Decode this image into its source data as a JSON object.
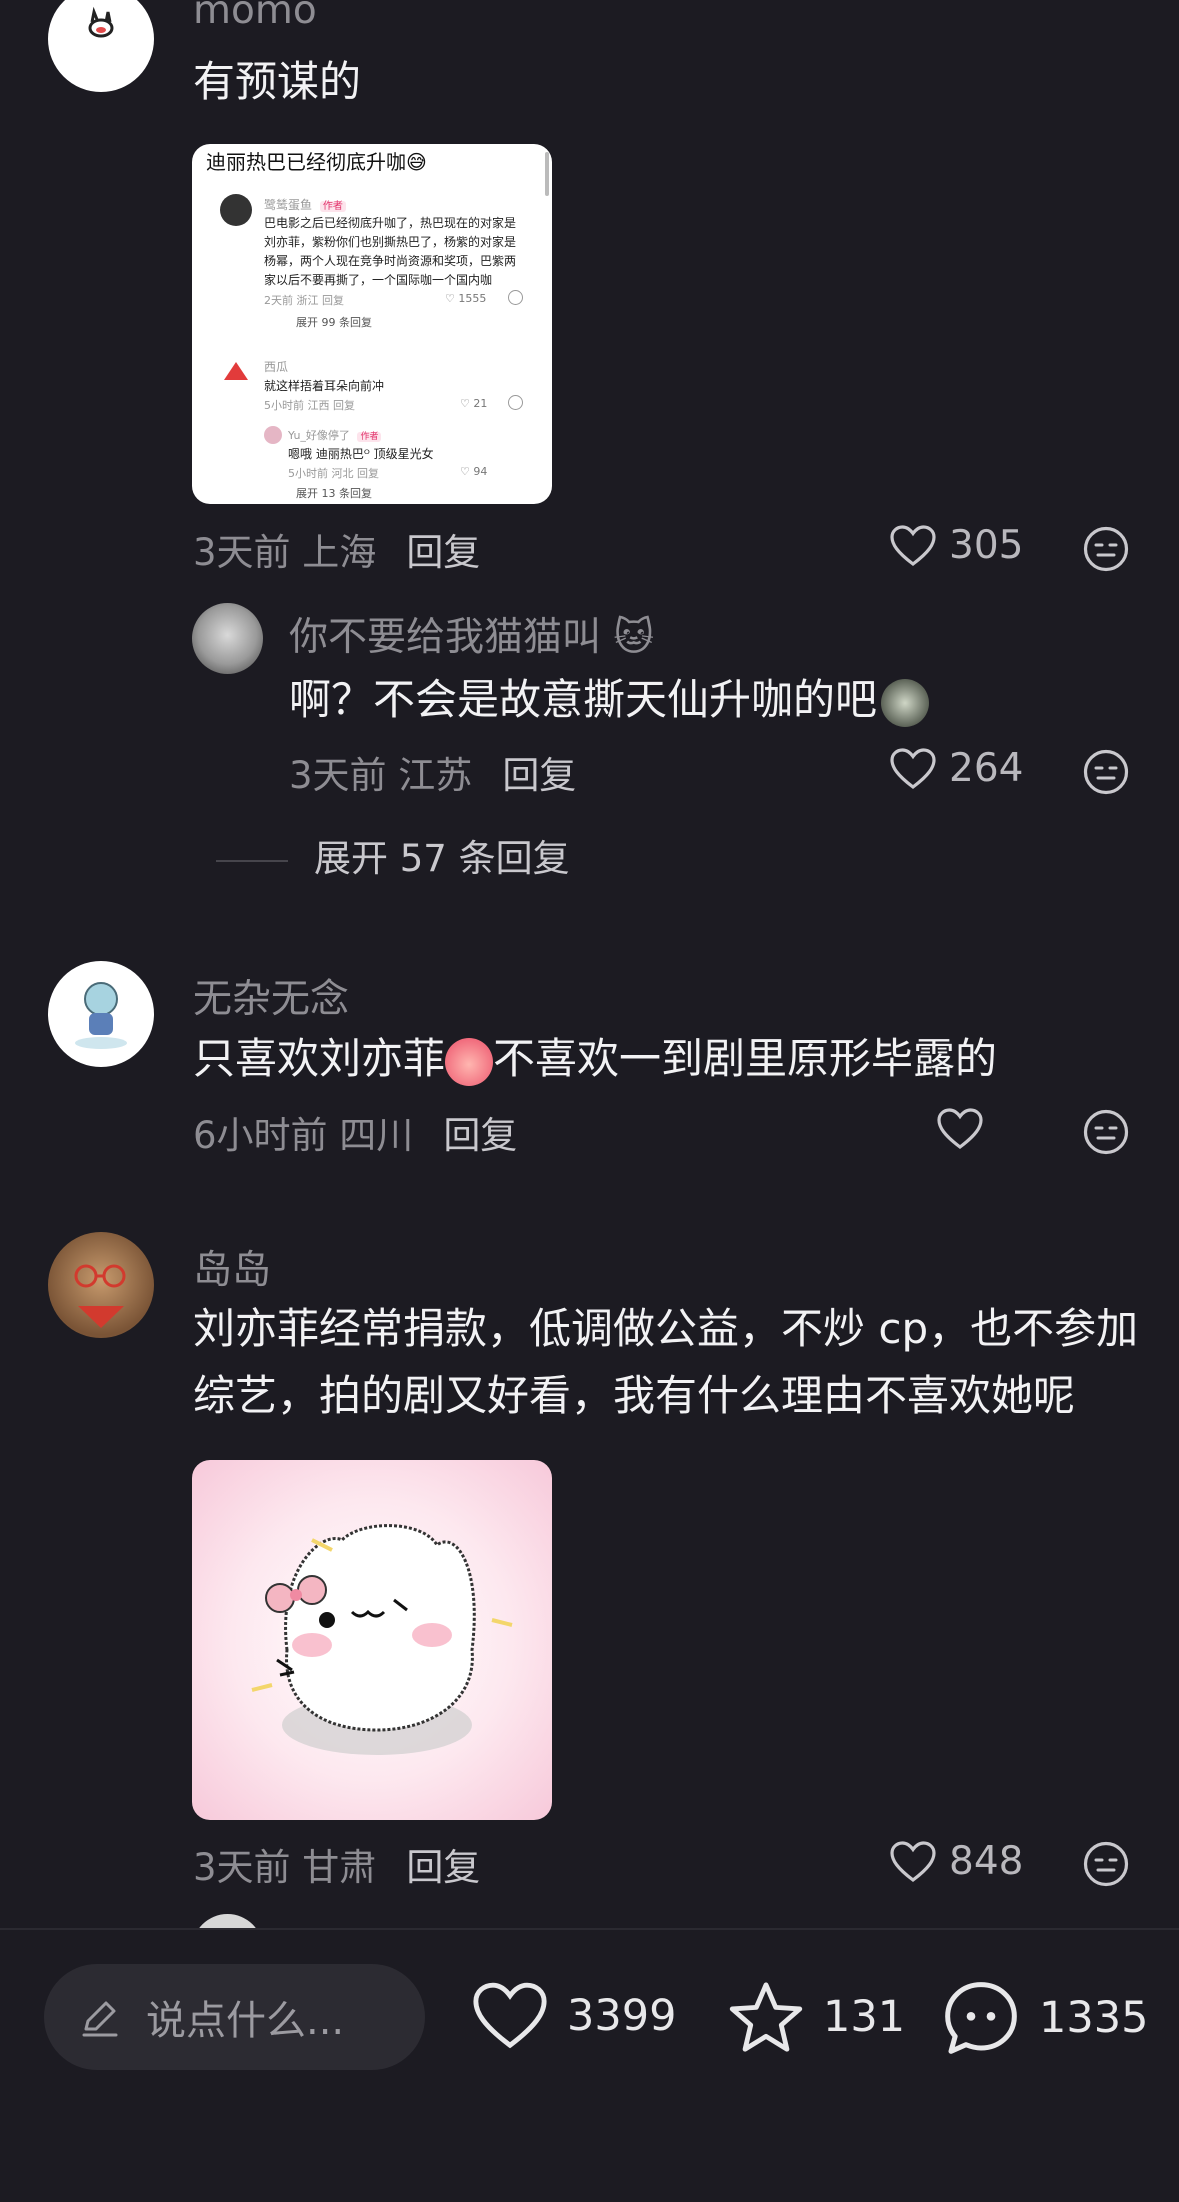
{
  "comments": [
    {
      "username": "momo",
      "text": "有预谋的",
      "image": {
        "title": "迪丽热巴已经彻底升咖😅",
        "c1_name": "鹭鸶蛋鱼",
        "c1_tag": "作者",
        "c1_line1": "巴电影之后已经彻底升咖了，热巴现在的对家是",
        "c1_line2": "刘亦菲，紫粉你们也别撕热巴了，杨紫的对家是",
        "c1_line3": "杨幂，两个人现在竞争时尚资源和奖项，巴紫两",
        "c1_line4": "家以后不要再撕了，一个国际咖一个国内咖",
        "c1_meta": "2天前 浙江  回复",
        "c1_likes": "1555",
        "c1_expand": "展开 99 条回复",
        "c2_name": "西瓜",
        "c2_text": "就这样捂着耳朵向前冲",
        "c2_meta": "5小时前 江西  回复",
        "c2_likes": "21",
        "c3_name": "Yu_好像停了",
        "c3_tag": "作者",
        "c3_text": "嗯哦  迪丽热巴ᴼ 顶级星光女",
        "c3_meta": "5小时前 河北  回复",
        "c3_likes": "94",
        "c3_expand": "展开 13 条回复"
      },
      "meta": "3天前 上海",
      "reply_label": "回复",
      "likes": "305"
    },
    {
      "username": "你不要给我猫猫叫 🐱",
      "text": "啊？不会是故意撕天仙升咖的吧",
      "meta": "3天前 江苏",
      "reply_label": "回复",
      "likes": "264",
      "expand": "展开 57 条回复"
    },
    {
      "username": "无杂无念",
      "text_a": "只喜欢刘亦菲",
      "text_b": "不喜欢一到剧里原形毕露的",
      "meta": "6小时前 四川",
      "reply_label": "回复",
      "likes": ""
    },
    {
      "username": "岛岛",
      "line1": "刘亦菲经常捐款，低调做公益，不炒 cp，也不参加",
      "line2": "综艺，拍的剧又好看，我有什么理由不喜欢她呢",
      "meta": "3天前 甘肃",
      "reply_label": "回复",
      "likes": "848"
    }
  ],
  "bottom_bar": {
    "input_placeholder": "说点什么...",
    "likes": "3399",
    "favorites": "131",
    "comments": "1335"
  },
  "icons": {
    "heart": "heart-outline-icon",
    "face": "neutral-face-icon",
    "pencil": "pencil-icon",
    "star": "star-outline-icon",
    "chat": "chat-bubble-icon"
  },
  "colors": {
    "background": "#1c1b22",
    "text_primary": "#f2f2f4",
    "text_secondary": "#8e8d93",
    "pill": "#2c2b32"
  }
}
